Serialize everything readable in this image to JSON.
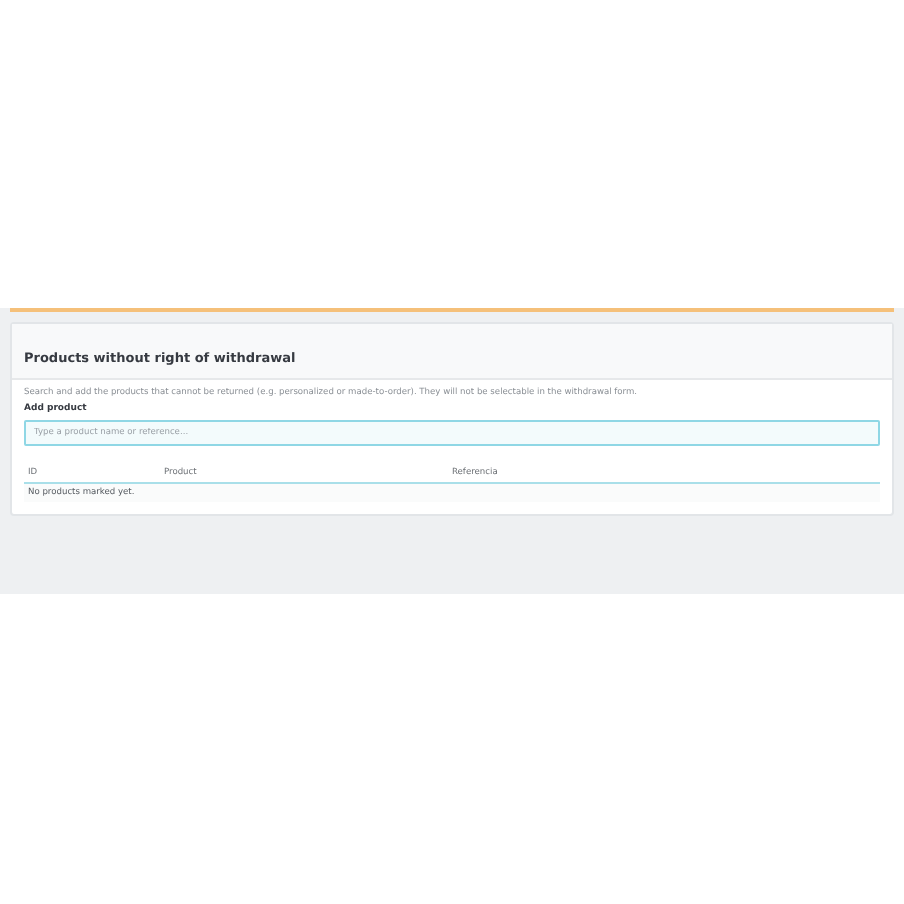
{
  "panel": {
    "title": "Products without right of withdrawal",
    "description": "Search and add the products that cannot be returned (e.g. personalized or made-to-order). They will not be selectable in the withdrawal form.",
    "field_label": "Add product",
    "search": {
      "placeholder": "Type a product name or reference..."
    },
    "table": {
      "columns": [
        "ID",
        "Product",
        "Referencia"
      ],
      "empty_message": "No products marked yet."
    }
  }
}
